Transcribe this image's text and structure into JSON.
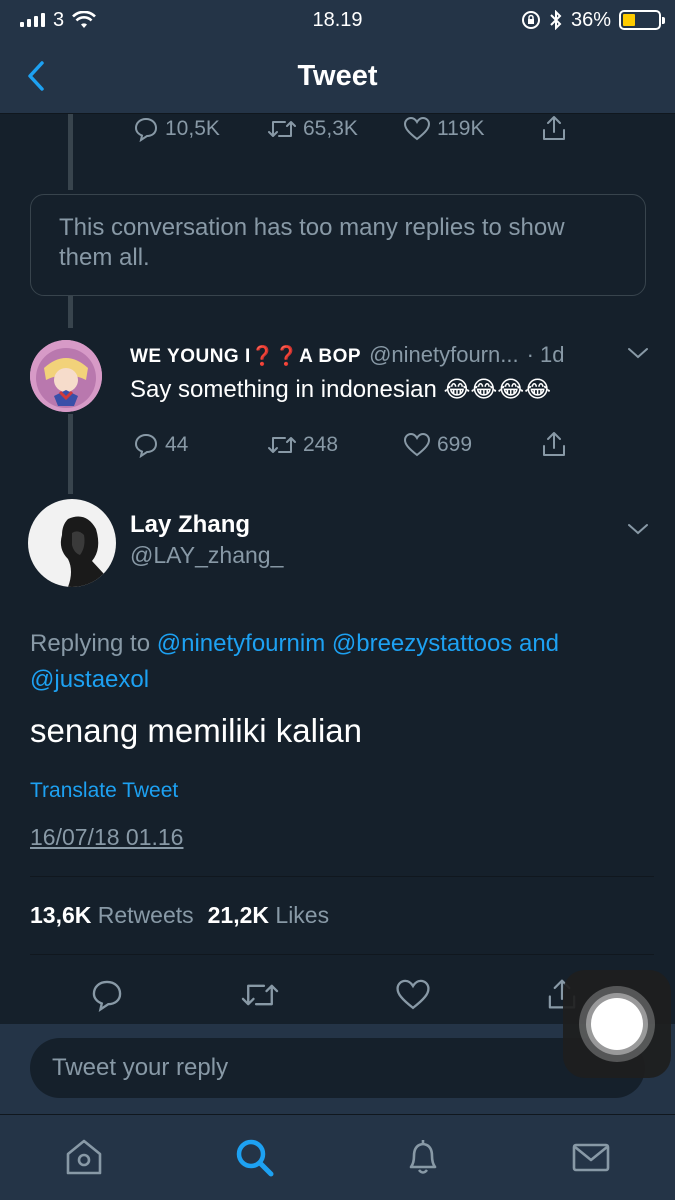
{
  "status_bar": {
    "carrier": "3",
    "time": "18.19",
    "battery": "36%",
    "battery_level": 0.36
  },
  "nav": {
    "title": "Tweet"
  },
  "parent_tweet_actions": {
    "replies": "10,5K",
    "retweets": "65,3K",
    "likes": "119K"
  },
  "conversation_notice": "This conversation has too many replies to show them all.",
  "reply_tweet": {
    "display_name": "WE YOUNG I❓❓A BOP",
    "handle": "@ninetyfourn...",
    "time": "· 1d",
    "text": "Say something in indonesian",
    "emojis": "😂😂😂😂",
    "replies": "44",
    "retweets": "248",
    "likes": "699"
  },
  "main_tweet": {
    "display_name": "Lay Zhang",
    "handle": "@LAY_zhang_",
    "replying_prefix": "Replying to ",
    "mention_1": "@ninetyfournim",
    "mention_2": "@breezystattoos",
    "and_text": "and",
    "mention_3": "@justaexol",
    "text": "senang memiliki kalian",
    "translate_label": "Translate Tweet",
    "timestamp": "16/07/18 01.16",
    "retweet_count": "13,6K",
    "retweet_label": "Retweets",
    "like_count": "21,2K",
    "like_label": "Likes"
  },
  "reply_bar": {
    "placeholder": "Tweet your reply"
  },
  "tabs": [
    "home-icon",
    "search-icon",
    "notifications-icon",
    "messages-icon"
  ],
  "colors": {
    "background": "#15202b",
    "bar": "#243447",
    "accent": "#1da1f2",
    "muted": "#8899a6"
  }
}
